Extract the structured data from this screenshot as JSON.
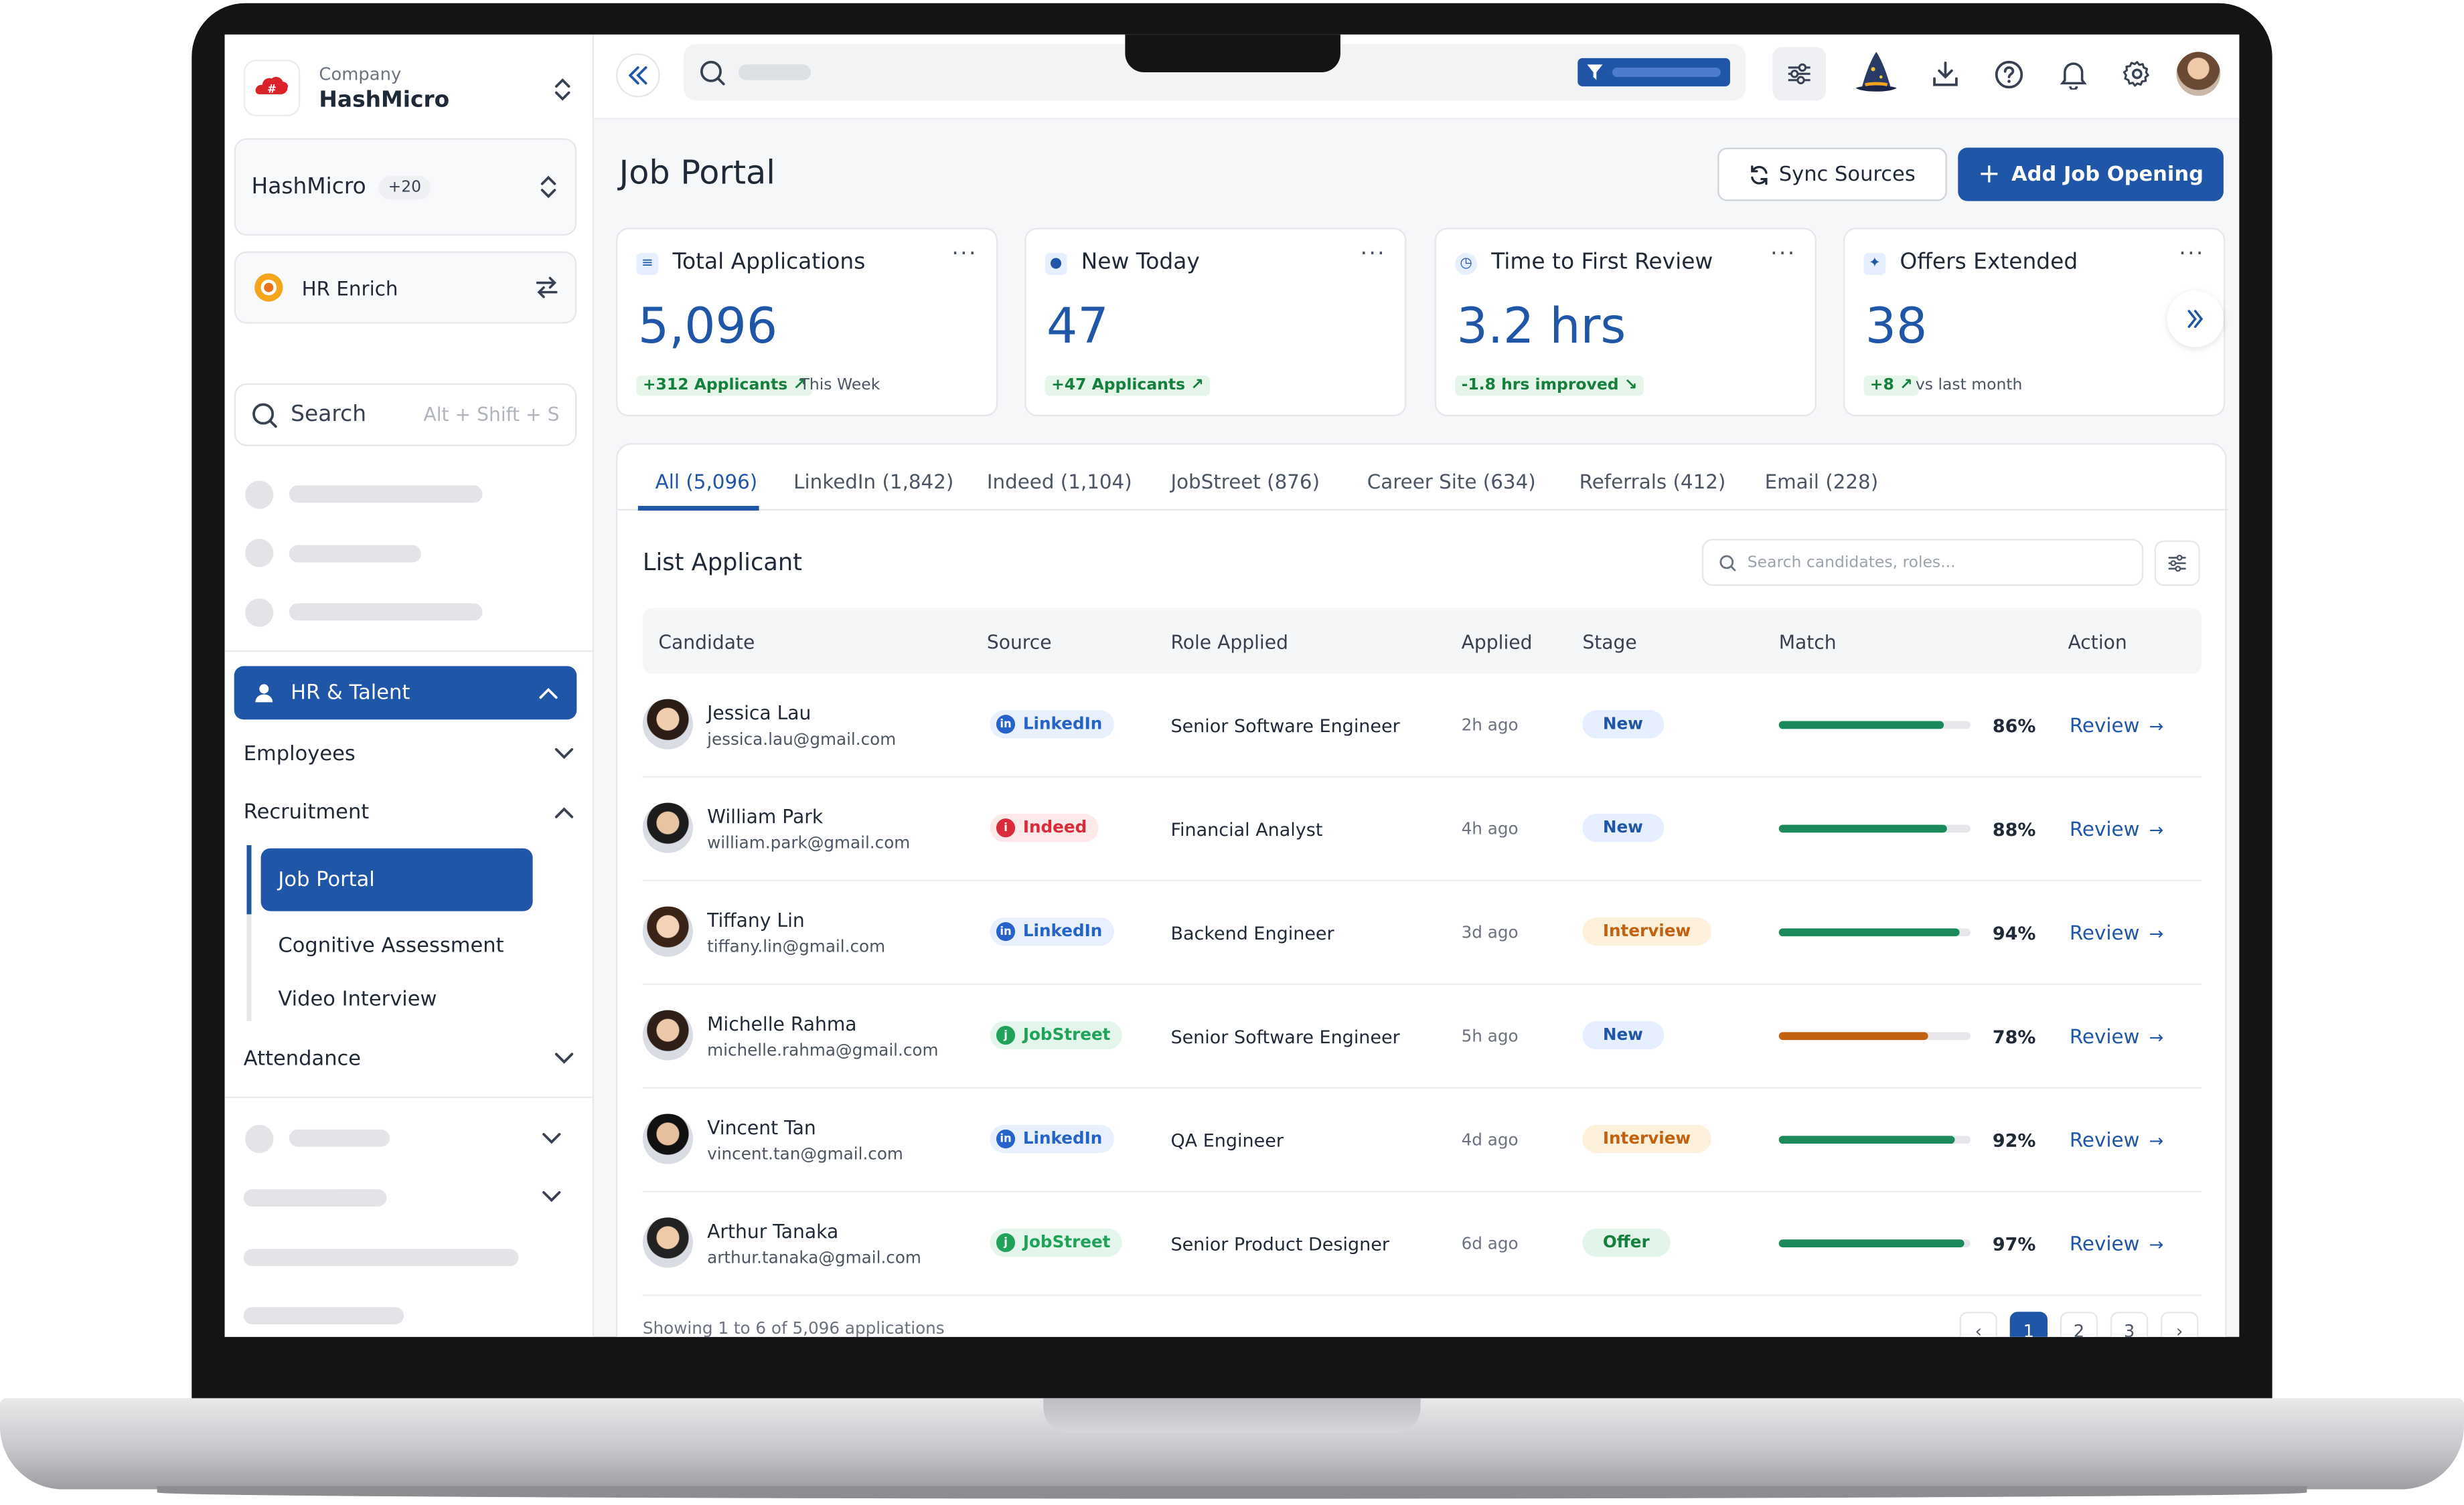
{
  "company": {
    "label": "Company",
    "name": "HashMicro"
  },
  "workspace": {
    "name": "HashMicro",
    "count": "+20"
  },
  "module": {
    "name": "HR Enrich"
  },
  "sidebar_search": {
    "label": "Search",
    "shortcut": "Alt + Shift + S"
  },
  "nav": {
    "section": "HR & Talent",
    "employees": "Employees",
    "recruitment": "Recruitment",
    "job_portal": "Job Portal",
    "cognitive": "Cognitive Assessment",
    "video": "Video Interview",
    "attendance": "Attendance"
  },
  "page": {
    "title": "Job Portal",
    "sync_label": "Sync Sources",
    "add_label": "Add Job Opening"
  },
  "stats": [
    {
      "title": "Total Applications",
      "value": "5,096",
      "badge": "+312 Applicants ↗",
      "sub": "This Week"
    },
    {
      "title": "New Today",
      "value": "47",
      "badge": "+47 Applicants ↗",
      "sub": ""
    },
    {
      "title": "Time to First Review",
      "value": "3.2 hrs",
      "badge": "-1.8 hrs improved ↘",
      "sub": ""
    },
    {
      "title": "Offers Extended",
      "value": "38",
      "badge": "+8 ↗",
      "sub": "vs last month"
    }
  ],
  "tabs": [
    {
      "label": "All (5,096)"
    },
    {
      "label": "LinkedIn (1,842)"
    },
    {
      "label": "Indeed (1,104)"
    },
    {
      "label": "JobStreet (876)"
    },
    {
      "label": "Career Site (634)"
    },
    {
      "label": "Referrals (412)"
    },
    {
      "label": "Email (228)"
    }
  ],
  "list": {
    "title": "List Applicant",
    "search_placeholder": "Search candidates, roles..."
  },
  "columns": [
    "Candidate",
    "Source",
    "Role Applied",
    "Applied",
    "Stage",
    "Match",
    "Action"
  ],
  "applicants": [
    {
      "name": "Jessica Lau",
      "email": "jessica.lau@gmail.com",
      "source": "LinkedIn",
      "role": "Senior Software Engineer",
      "applied": "2h ago",
      "stage": "New",
      "match": "86%",
      "match_value": 0.86,
      "match_color": "#1a8a5a",
      "action": "Review"
    },
    {
      "name": "William Park",
      "email": "william.park@gmail.com",
      "source": "Indeed",
      "role": "Financial Analyst",
      "applied": "4h ago",
      "stage": "New",
      "match": "88%",
      "match_value": 0.88,
      "match_color": "#1a8a5a",
      "action": "Review"
    },
    {
      "name": "Tiffany Lin",
      "email": "tiffany.lin@gmail.com",
      "source": "LinkedIn",
      "role": "Backend Engineer",
      "applied": "3d ago",
      "stage": "Interview",
      "match": "94%",
      "match_value": 0.94,
      "match_color": "#1a8a5a",
      "action": "Review"
    },
    {
      "name": "Michelle Rahma",
      "email": "michelle.rahma@gmail.com",
      "source": "JobStreet",
      "role": "Senior Software Engineer",
      "applied": "5h ago",
      "stage": "New",
      "match": "78%",
      "match_value": 0.78,
      "match_color": "#c2610f",
      "action": "Review"
    },
    {
      "name": "Vincent Tan",
      "email": "vincent.tan@gmail.com",
      "source": "LinkedIn",
      "role": "QA Engineer",
      "applied": "4d ago",
      "stage": "Interview",
      "match": "92%",
      "match_value": 0.92,
      "match_color": "#1a8a5a",
      "action": "Review"
    },
    {
      "name": "Arthur Tanaka",
      "email": "arthur.tanaka@gmail.com",
      "source": "JobStreet",
      "role": "Senior Product Designer",
      "applied": "6d ago",
      "stage": "Offer",
      "match": "97%",
      "match_value": 0.97,
      "match_color": "#1a8a5a",
      "action": "Review"
    }
  ],
  "footer": {
    "showing": "Showing 1 to 6 of 5,096 applications"
  },
  "pagination": {
    "prev": "‹",
    "pages": [
      "1",
      "2",
      "3"
    ],
    "next": "›"
  },
  "colors": {
    "primary": "#1f56a8",
    "linkedin": "#2563c9",
    "indeed": "#d92b3a",
    "jobstreet": "#1fa35a",
    "new": "#e6efff",
    "interview": "#fdf1dc",
    "offer": "#e3f5ea"
  }
}
